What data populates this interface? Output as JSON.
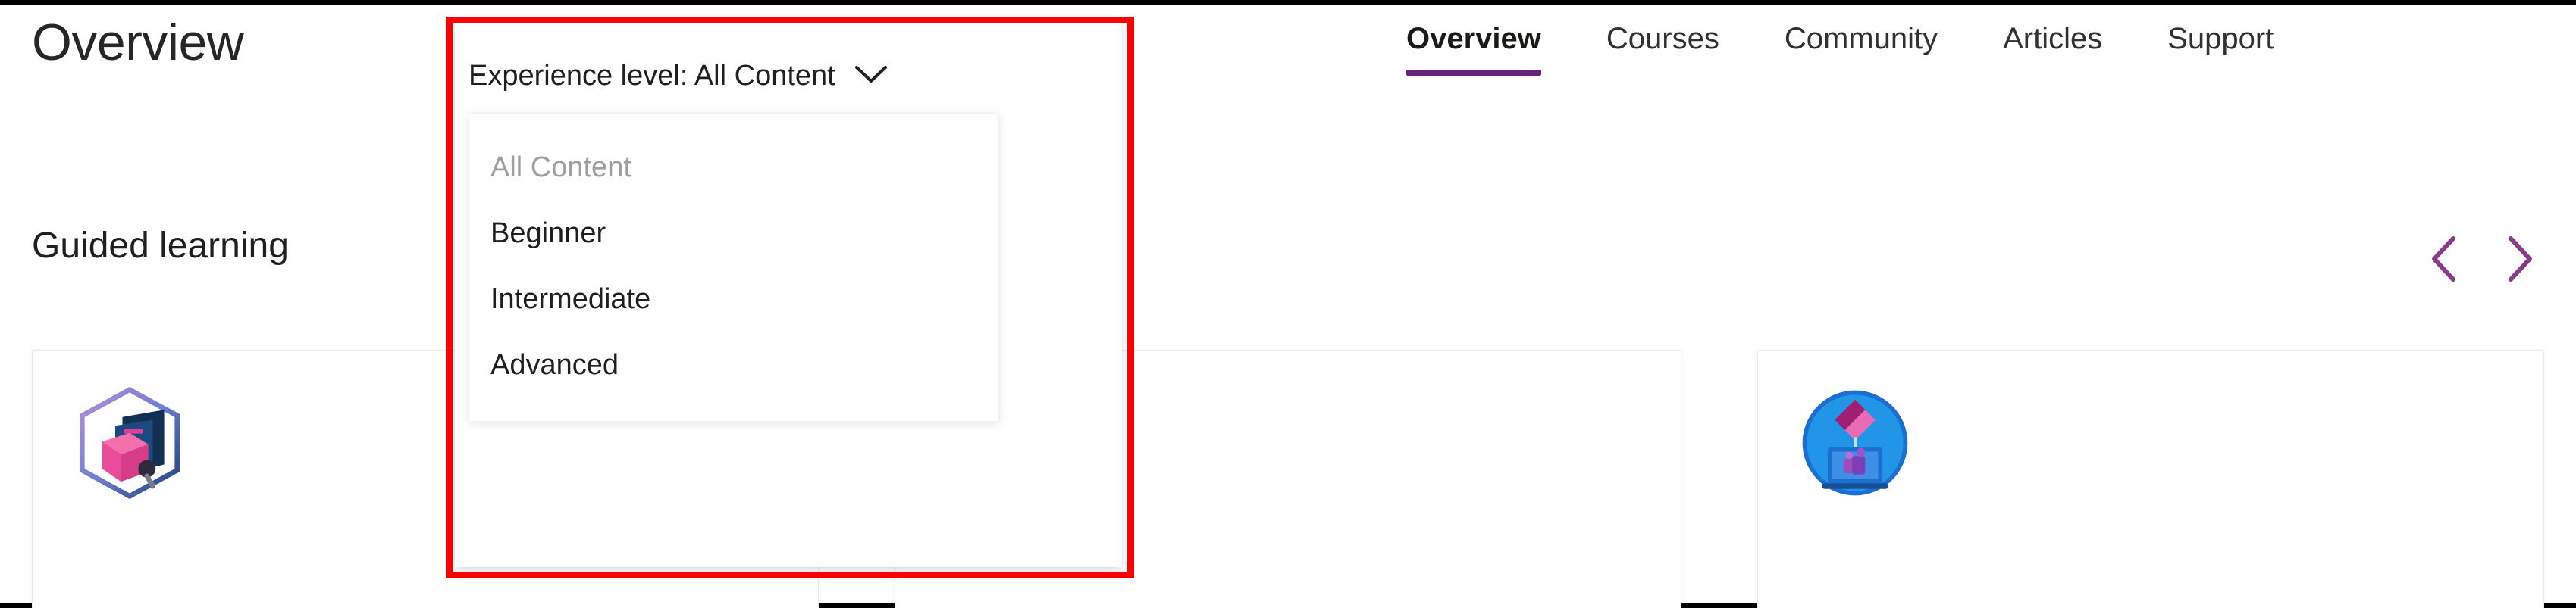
{
  "header": {
    "page_title": "Overview"
  },
  "nav": {
    "items": [
      {
        "label": "Overview",
        "active": true
      },
      {
        "label": "Courses",
        "active": false
      },
      {
        "label": "Community",
        "active": false
      },
      {
        "label": "Articles",
        "active": false
      },
      {
        "label": "Support",
        "active": false
      }
    ],
    "active_underline_color": "#69217a"
  },
  "section": {
    "title": "Guided learning",
    "prev_icon": "chevron-left-icon",
    "next_icon": "chevron-right-icon",
    "arrow_color": "#8a3a8a"
  },
  "filter": {
    "button_label": "Experience level: All Content",
    "chevron_icon": "chevron-down-icon",
    "selected_value": "All Content",
    "options": [
      {
        "label": "All Content",
        "selected": true
      },
      {
        "label": "Beginner",
        "selected": false
      },
      {
        "label": "Intermediate",
        "selected": false
      },
      {
        "label": "Advanced",
        "selected": false
      }
    ]
  },
  "cards": [
    {
      "icon_name": "hexagon-badge-cube-screens-icon"
    },
    {
      "icon_name": "circle-badge-window-cube-list-icon"
    },
    {
      "icon_name": "circle-badge-laptop-teams-icon"
    }
  ],
  "annotation": {
    "name": "red-highlight-box",
    "color": "#ff0000"
  }
}
